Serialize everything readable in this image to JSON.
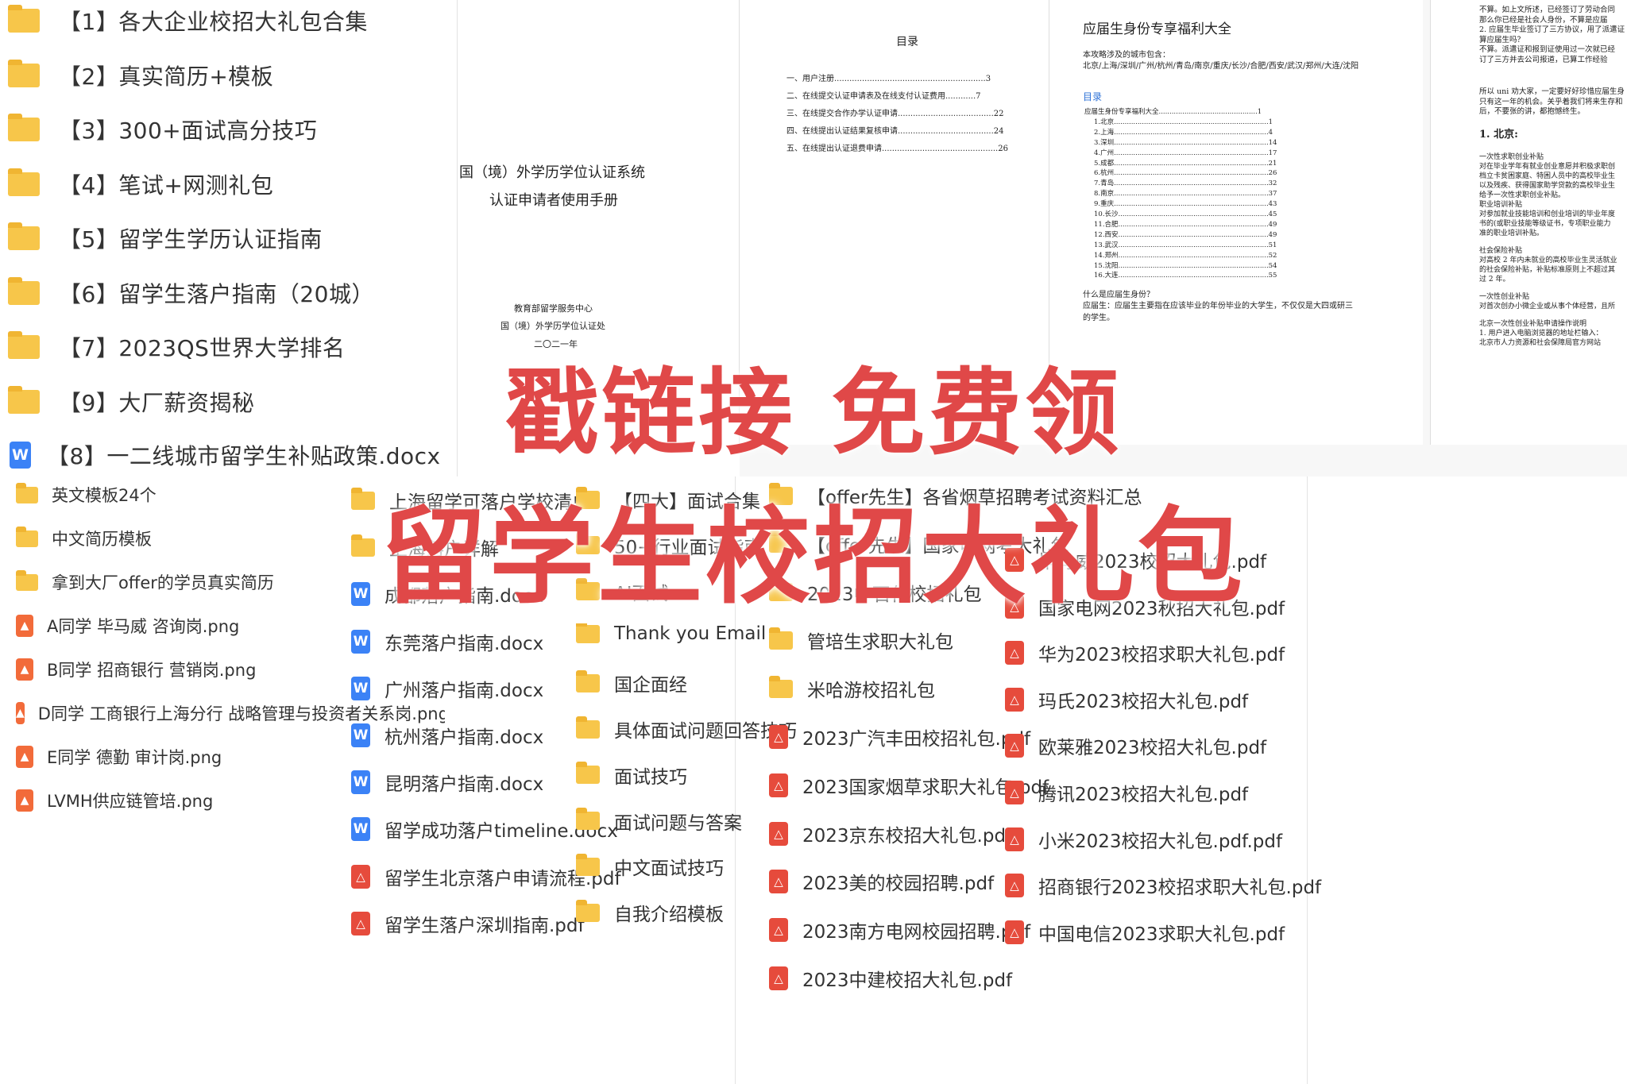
{
  "left_folders": [
    "【1】各大企业校招大礼包合集",
    "【2】真实简历+模板",
    "【3】300+面试高分技巧",
    "【4】笔试+网测礼包",
    "【5】留学生学历认证指南",
    "【6】留学生落户指南（20城）",
    "【7】2023QS世界大学排名",
    "【9】大厂薪资揭秘"
  ],
  "left_doc": "【8】一二线城市留学生补贴政策.docx",
  "left_small": [
    {
      "icon": "folder",
      "label": "英文模板24个"
    },
    {
      "icon": "folder",
      "label": "中文简历模板"
    },
    {
      "icon": "folder",
      "label": "拿到大厂offer的学员真实简历"
    },
    {
      "icon": "img",
      "label": "A同学 毕马威  咨询岗.png"
    },
    {
      "icon": "img",
      "label": "B同学 招商银行 营销岗.png"
    },
    {
      "icon": "img",
      "label": "D同学 工商银行上海分行 战略管理与投资者关系岗.png"
    },
    {
      "icon": "img",
      "label": "E同学 德勤 审计岗.png"
    },
    {
      "icon": "img",
      "label": "LVMH供应链管培.png"
    }
  ],
  "col2": [
    {
      "icon": "folder",
      "label": "上海留学可落户学校清单"
    },
    {
      "icon": "folder",
      "label": "上海落户详解"
    },
    {
      "icon": "word",
      "label": "成都落户指南.docx"
    },
    {
      "icon": "word",
      "label": "东莞落户指南.docx"
    },
    {
      "icon": "word",
      "label": "广州落户指南.docx"
    },
    {
      "icon": "word",
      "label": "杭州落户指南.docx"
    },
    {
      "icon": "word",
      "label": "昆明落户指南.docx"
    },
    {
      "icon": "word",
      "label": "留学成功落户timeline.docx"
    },
    {
      "icon": "pdf",
      "label": "留学生北京落户申请流程.pdf"
    },
    {
      "icon": "pdf",
      "label": "留学生落户深圳指南.pdf"
    }
  ],
  "col3": [
    {
      "icon": "folder",
      "label": "【四大】面试合集"
    },
    {
      "icon": "folder",
      "label": "50+行业面试指南"
    },
    {
      "icon": "folder",
      "label": "AI面试"
    },
    {
      "icon": "folder",
      "label": "Thank you Email"
    },
    {
      "icon": "folder",
      "label": "国企面经"
    },
    {
      "icon": "folder",
      "label": "具体面试问题回答技巧"
    },
    {
      "icon": "folder",
      "label": "面试技巧"
    },
    {
      "icon": "folder",
      "label": "面试问题与答案"
    },
    {
      "icon": "folder",
      "label": "中文面试技巧"
    },
    {
      "icon": "folder",
      "label": "自我介绍模板"
    }
  ],
  "col4": [
    {
      "icon": "folder",
      "label": "【offer先生】各省烟草招聘考试资料汇总"
    },
    {
      "icon": "folder",
      "label": "【offer先生】国家电网考大礼包"
    },
    {
      "icon": "folder",
      "label": "2023中石化校招礼包"
    },
    {
      "icon": "folder",
      "label": "管培生求职大礼包"
    },
    {
      "icon": "folder",
      "label": "米哈游校招礼包"
    },
    {
      "icon": "pdf",
      "label": "2023广汽丰田校招礼包.pdf"
    },
    {
      "icon": "pdf",
      "label": "2023国家烟草求职大礼包.pdf"
    },
    {
      "icon": "pdf",
      "label": "2023京东校招大礼包.pdf"
    },
    {
      "icon": "pdf",
      "label": "2023美的校园招聘.pdf"
    },
    {
      "icon": "pdf",
      "label": "2023南方电网校园招聘.pdf"
    },
    {
      "icon": "pdf",
      "label": "2023中建校招大礼包.pdf"
    }
  ],
  "col5": [
    {
      "icon": "pdf",
      "label": "毕马威2023校招大礼包.pdf"
    },
    {
      "icon": "pdf",
      "label": "国家电网2023秋招大礼包.pdf"
    },
    {
      "icon": "pdf",
      "label": "华为2023校招求职大礼包.pdf"
    },
    {
      "icon": "pdf",
      "label": "玛氏2023校招大礼包.pdf"
    },
    {
      "icon": "pdf",
      "label": "欧莱雅2023校招大礼包.pdf"
    },
    {
      "icon": "pdf",
      "label": "腾讯2023校招大礼包.pdf"
    },
    {
      "icon": "pdf",
      "label": "小米2023校招大礼包.pdf.pdf"
    },
    {
      "icon": "pdf",
      "label": "招商银行2023校招求职大礼包.pdf"
    },
    {
      "icon": "pdf",
      "label": "中国电信2023求职大礼包.pdf"
    }
  ],
  "doc1": {
    "toc_title": "目录",
    "toc": [
      "一、用户注册............................................................3",
      "二、在线提交认证申请表及在线支付认证费用............7",
      "三、在线提交合作办学认证申请......................................22",
      "四、在线提出认证结果复核申请......................................24",
      "五、在线提出认证退费申请..............................................26"
    ],
    "title1": "国（境）外学历学位认证系统",
    "title2": "认证申请者使用手册",
    "org1": "教育部留学服务中心",
    "org2": "国（境）外学历学位认证处",
    "year": "二〇二一年"
  },
  "doc2": {
    "title": "应届生身份专享福利大全",
    "intro": "本攻略涉及的城市包含：",
    "cities": "北京/上海/深圳/广州/杭州/青岛/南京/重庆/长沙/合肥/西安/武汉/郑州/大连/沈阳",
    "toc_label": "目录",
    "toc": [
      "应届生身份专享福利大全..............................................1",
      "1.北京........................................................................1",
      "2.上海........................................................................4",
      "3.深圳........................................................................14",
      "4.广州........................................................................17",
      "5.成都........................................................................21",
      "6.杭州........................................................................26",
      "7.青岛........................................................................32",
      "8.南京........................................................................37",
      "9.重庆........................................................................43",
      "10.长沙......................................................................45",
      "11.合肥......................................................................49",
      "12.西安......................................................................49",
      "13.武汉......................................................................51",
      "14.郑州......................................................................52",
      "15.沈阳......................................................................54",
      "16.大连......................................................................55"
    ],
    "q": "什么是应届生身份？",
    "a": "应届生：应届生主要指在应该毕业的年份毕业的大学生，不仅仅是大四或研三的学生。"
  },
  "doc3": {
    "lines": [
      "不算。如上文所述，已经签订了劳动合同",
      "那么你已经是社会人身份，不算是应届",
      "2. 应届生毕业签订了三方协议，用了派遣证",
      "算应届生吗？",
      "不算。派遣证和报到证使用过一次就已经",
      "订了三方并去公司报道，已算工作经验",
      "所以 uni 劝大家，一定要好好珍惜应届生身",
      "只有这一年的机会。关乎着我们将来生存和",
      "后，不要张的讲，都抱憾终生。"
    ],
    "heading": "1. 北京:",
    "body": [
      "一次性求职创业补贴",
      "对在毕业学年有就业创业意愿并积极求职创",
      "档立卡贫困家庭、特困人员中的高校毕业生",
      "以及残疾、获得国家助学贷款的高校毕业生",
      "给予一次性求职创业补贴。",
      "职业培训补贴",
      "对参加就业技能培训和创业培训的毕业年度",
      "书的(或职业技能等级证书，专项职业能力",
      "准的职业培训补贴。",
      "社会保险补贴",
      "对高校 2 年内未就业的高校毕业生灵活就业",
      "的社会保险补贴，补贴标准原则上不超过其",
      "过 2 年。",
      "一次性创业补贴",
      "对首次创办小微企业或从事个体经营，且所",
      "北京一次性创业补贴申请操作说明",
      "1. 用户进入电脑浏览器的地址栏输入：",
      "北京市人力资源和社会保障局官方网站"
    ]
  },
  "overlay": {
    "line1": "戳链接 免费领",
    "line2": "留学生校招大礼包"
  },
  "colors": {
    "accent": "#e04848",
    "folder": "#f7c64a",
    "word": "#3b82f6",
    "pdf": "#e64b3c"
  }
}
